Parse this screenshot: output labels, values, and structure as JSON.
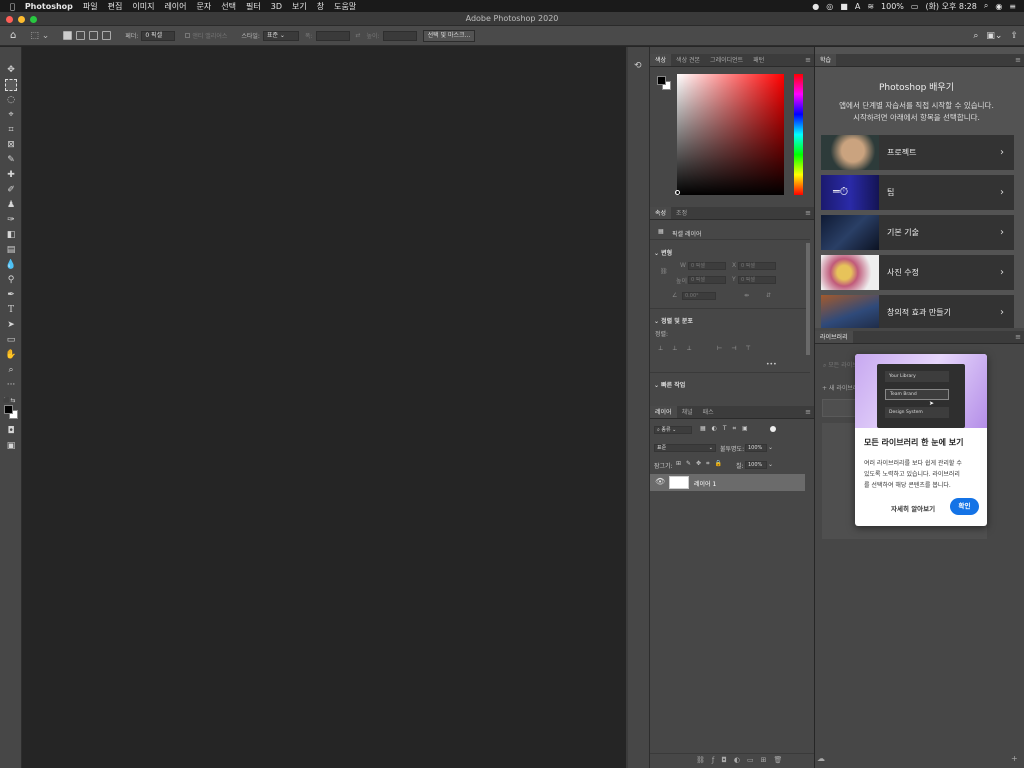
{
  "menubar": {
    "apple": "",
    "app_name": "Photoshop",
    "items": [
      "파일",
      "편집",
      "이미지",
      "레이어",
      "문자",
      "선택",
      "필터",
      "3D",
      "보기",
      "창",
      "도움말"
    ],
    "battery": "100%",
    "datetime": "(화) 오후 8:28"
  },
  "window": {
    "title": "Adobe Photoshop 2020"
  },
  "options": {
    "feather_label": "페더:",
    "feather_value": "0 픽셀",
    "antialias_label": "앤티 앨리어스",
    "style_label": "스타일:",
    "style_value": "표준",
    "width_label": "폭:",
    "height_label": "높이:",
    "select_mask_button": "선택 및 마스크..."
  },
  "color_panel": {
    "tabs": [
      "색상",
      "색상 견본",
      "그레이디언트",
      "패턴"
    ]
  },
  "properties_panel": {
    "tabs": [
      "속성",
      "조정"
    ],
    "layer_type": "픽셀 레이어",
    "transform_section": "변형",
    "w_label": "W",
    "w_value": "0 픽셀",
    "x_label": "X",
    "x_value": "0 픽셀",
    "h_label": "높이",
    "h_value": "0 픽셀",
    "y_label": "Y",
    "y_value": "0 픽셀",
    "angle_value": "0.00°",
    "align_section": "정렬 및 분포",
    "align_label": "정렬:",
    "quick_actions": "빠른 작업"
  },
  "layers_panel": {
    "tabs": [
      "레이어",
      "채널",
      "패스"
    ],
    "filter_kind": "종류",
    "blend_mode": "표준",
    "opacity_label": "불투명도:",
    "opacity_value": "100%",
    "lock_label": "잠그기:",
    "fill_label": "칠:",
    "fill_value": "100%",
    "layers": [
      {
        "name": "레이어 1"
      }
    ]
  },
  "learn_panel": {
    "tab": "학습",
    "heading": "Photoshop 배우기",
    "desc_line1": "앱에서 단계별 자습서를 직접 시작할 수 있습니다.",
    "desc_line2": "시작하려면 아래에서 항목을 선택합니다.",
    "cards": [
      {
        "label": "프로젝트"
      },
      {
        "label": "팁"
      },
      {
        "label": "기본 기술"
      },
      {
        "label": "사진 수정"
      },
      {
        "label": "창의적 효과 만들기"
      }
    ]
  },
  "library_panel": {
    "tab": "라이브러리",
    "search_placeholder": "모든 라이브러리 검색",
    "new_library": "+ 새 라이브러리",
    "popup": {
      "preview_items": [
        "Your Library",
        "Team Brand",
        "Design System"
      ],
      "title": "모든 라이브러리 한 눈에 보기",
      "body_line1": "여러 라이브러리를 보다 쉽게 관리할 수",
      "body_line2": "있도록 노력하고 있습니다. 라이브러리",
      "body_line3": "를 선택하여 해당 콘텐츠를 봅니다.",
      "learn_more": "자세히 알아보기",
      "confirm": "확인"
    }
  },
  "colors": {
    "accent": "#1473e6",
    "fg": "#000000",
    "bg": "#ffffff",
    "picker_hue": "#ff0000"
  }
}
